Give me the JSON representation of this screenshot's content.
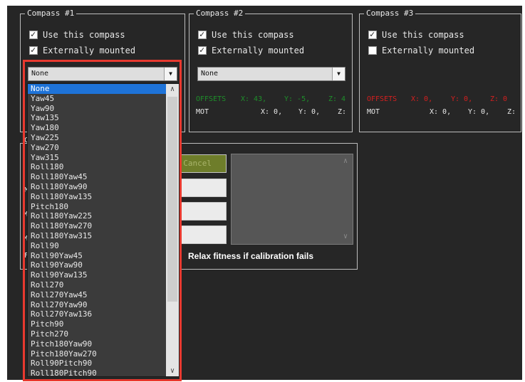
{
  "compass1": {
    "title": "Compass #1",
    "use_label": "Use this compass",
    "use_checked": true,
    "ext_label": "Externally mounted",
    "ext_checked": true,
    "orientation_value": "None"
  },
  "compass2": {
    "title": "Compass #2",
    "use_label": "Use this compass",
    "use_checked": true,
    "ext_label": "Externally mounted",
    "ext_checked": true,
    "orientation_value": "None",
    "offsets_label": "OFFSETS",
    "offsets_x": "X: 43,",
    "offsets_y": "Y: -5,",
    "offsets_z": "Z: 4",
    "mot_label": "MOT",
    "mot_x": "X: 0,",
    "mot_y": "Y: 0,",
    "mot_z": "Z:"
  },
  "compass3": {
    "title": "Compass #3",
    "use_label": "Use this compass",
    "use_checked": true,
    "ext_label": "Externally mounted",
    "ext_checked": false,
    "offsets_label": "OFFSETS",
    "offsets_x": "X: 0,",
    "offsets_y": "Y: 0,",
    "offsets_z": "Z: 0",
    "mot_label": "MOT",
    "mot_x": "X: 0,",
    "mot_y": "Y: 0,",
    "mot_z": "Z:"
  },
  "calibration": {
    "cancel_label": "Cancel",
    "relax_label": "Relax fitness if calibration fails",
    "partial_letters": [
      "C",
      "M",
      "M",
      "M",
      "F"
    ]
  },
  "orientation_dropdown": {
    "selected": "None",
    "items": [
      "None",
      "Yaw45",
      "Yaw90",
      "Yaw135",
      "Yaw180",
      "Yaw225",
      "Yaw270",
      "Yaw315",
      "Roll180",
      "Roll180Yaw45",
      "Roll180Yaw90",
      "Roll180Yaw135",
      "Pitch180",
      "Roll180Yaw225",
      "Roll180Yaw270",
      "Roll180Yaw315",
      "Roll90",
      "Roll90Yaw45",
      "Roll90Yaw90",
      "Roll90Yaw135",
      "Roll270",
      "Roll270Yaw45",
      "Roll270Yaw90",
      "Roll270Yaw136",
      "Pitch90",
      "Pitch270",
      "Pitch180Yaw90",
      "Pitch180Yaw270",
      "Roll90Pitch90",
      "Roll180Pitch90"
    ]
  },
  "colors": {
    "background": "#262626",
    "selection": "#1e73d8",
    "highlight_frame": "#e8392f",
    "offsets_green": "#1e8f2a",
    "offsets_red": "#d51f1f"
  },
  "icons": {
    "checkmark": "checkmark-icon",
    "dropdown_arrow": "chevron-down-icon",
    "scroll_up": "chevron-up-icon",
    "scroll_down": "chevron-down-icon"
  }
}
